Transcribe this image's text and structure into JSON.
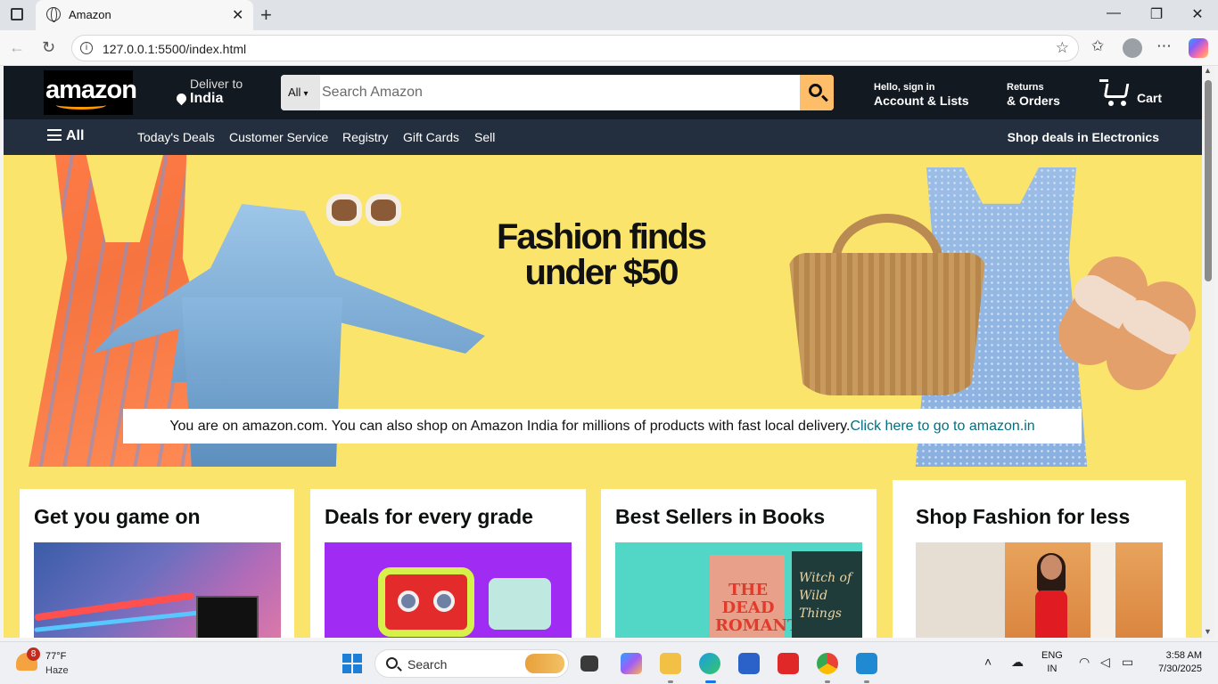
{
  "browser": {
    "tab_title": "Amazon",
    "tab_close": "✕",
    "new_tab": "+",
    "url": "127.0.0.1:5500/index.html",
    "window_controls": {
      "minimize": "—",
      "restore": "❐",
      "close": "✕"
    }
  },
  "amazon": {
    "logo_text": "amazon",
    "deliver": {
      "line1": "Deliver to",
      "line2": "India"
    },
    "search": {
      "category": "All",
      "placeholder": "Search Amazon"
    },
    "account": {
      "line1": "Hello, sign in",
      "line2": "Account & Lists"
    },
    "orders": {
      "line1": "Returns",
      "line2": "& Orders"
    },
    "cart_label": "Cart",
    "nav": {
      "all_label": "All",
      "links": [
        "Today's Deals",
        "Customer Service",
        "Registry",
        "Gift Cards",
        "Sell"
      ],
      "promo": "Shop deals in Electronics"
    },
    "hero": {
      "headline_1": "Fashion finds",
      "headline_2": "under $50",
      "notice_text": "You are on amazon.com. You can also shop on Amazon India for millions of products with fast local delivery.",
      "notice_link": "Click here to go to amazon.in"
    },
    "cards": [
      {
        "title": "Get you game on"
      },
      {
        "title": "Deals for every grade"
      },
      {
        "title": "Best Sellers in Books",
        "book1_text": "THE DEAD ROMANTICS",
        "book2_text": "Witch of Wild Things"
      },
      {
        "title": "Shop Fashion for less"
      }
    ],
    "colors": {
      "header_dark": "#131921",
      "nav_dark": "#232f3e",
      "search_button": "#febd69",
      "hero_yellow": "#fbe46c",
      "link_teal": "#007185"
    }
  },
  "taskbar": {
    "weather": {
      "temp": "77°F",
      "condition": "Haze",
      "badge": "8"
    },
    "search_label": "Search",
    "lang_1": "ENG",
    "lang_2": "IN",
    "time": "3:58 AM",
    "date": "7/30/2025"
  }
}
